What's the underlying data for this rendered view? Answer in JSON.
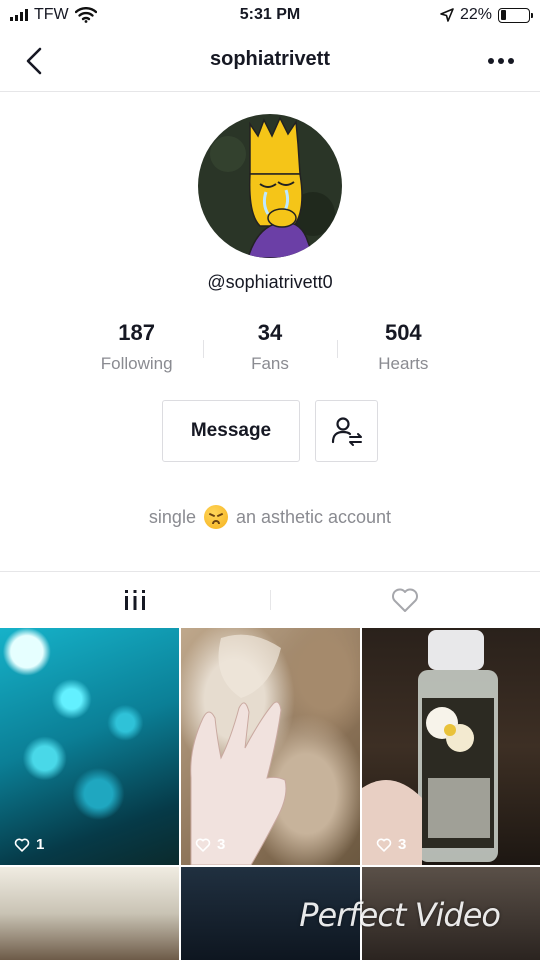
{
  "status_bar": {
    "carrier": "TFW",
    "time": "5:31 PM",
    "battery_percent": "22%",
    "battery_level": 0.22
  },
  "nav": {
    "title": "sophiatrivett"
  },
  "profile": {
    "handle": "@sophiatrivett0",
    "stats": [
      {
        "value": "187",
        "label": "Following"
      },
      {
        "value": "34",
        "label": "Fans"
      },
      {
        "value": "504",
        "label": "Hearts"
      }
    ],
    "message_label": "Message",
    "bio_before": "single",
    "bio_after": "an asthetic account"
  },
  "grid": {
    "videos": [
      {
        "likes": "1"
      },
      {
        "likes": "3"
      },
      {
        "likes": "3"
      }
    ]
  },
  "watermark": "Perfect Video"
}
